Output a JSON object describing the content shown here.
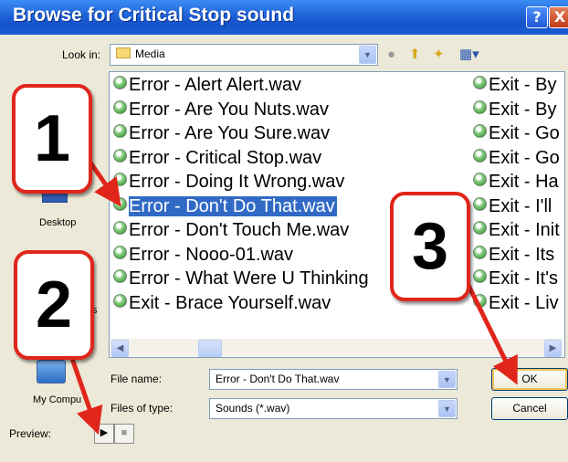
{
  "window": {
    "title": "Browse for Critical Stop sound",
    "help_glyph": "?",
    "close_glyph": "X"
  },
  "lookin": {
    "label": "Look in:",
    "value": "Media"
  },
  "toolbar": {
    "back_icon": "back-icon",
    "up_icon": "up-folder-icon",
    "newfolder_icon": "new-folder-icon",
    "views_icon": "views-menu-icon"
  },
  "places": {
    "desktop": "Desktop",
    "my_computer": "My Compu",
    "partial_label": "ts"
  },
  "files": {
    "column1": [
      "Error - Alert Alert.wav",
      "Error - Are You Nuts.wav",
      "Error - Are You Sure.wav",
      "Error - Critical Stop.wav",
      "Error - Doing It Wrong.wav",
      "Error - Don't Do That.wav",
      "Error - Don't Touch Me.wav",
      "Error - Nooo-01.wav",
      "Error - What Were U Thinking",
      "Exit - Brace Yourself.wav"
    ],
    "column2": [
      "Exit - By",
      "Exit - By",
      "Exit - Go",
      "Exit - Go",
      "Exit - Ha",
      "Exit - I'll",
      "Exit - Init",
      "Exit - Its",
      "Exit - It's",
      "Exit - Liv"
    ],
    "selected_index": 5
  },
  "fields": {
    "filename_label": "File name:",
    "filename_value": "Error - Don't Do That.wav",
    "filetype_label": "Files of type:",
    "filetype_value": "Sounds (*.wav)"
  },
  "buttons": {
    "ok": "OK",
    "cancel": "Cancel"
  },
  "preview": {
    "label": "Preview:",
    "play_glyph": "▶",
    "stop_glyph": "■"
  },
  "callouts": [
    "1",
    "2",
    "3"
  ],
  "colors": {
    "callout_border": "#e0261b",
    "selection": "#316ac5",
    "titlebar": "#1f62d8"
  }
}
